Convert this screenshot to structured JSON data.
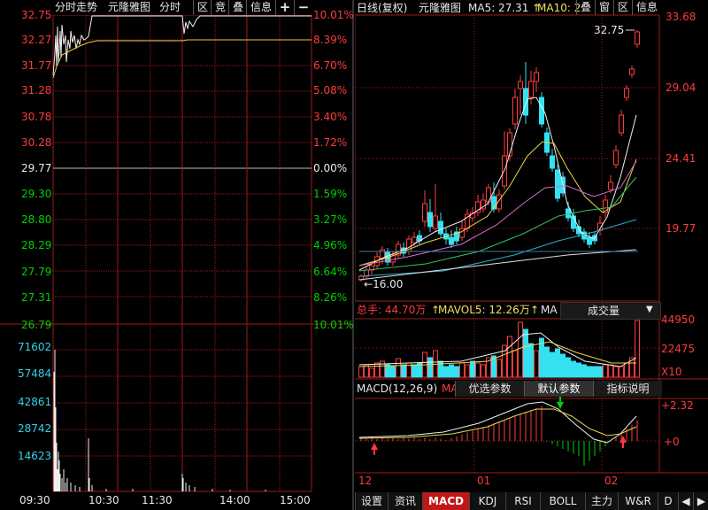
{
  "intraday": {
    "tabs": [
      "分时走势",
      "元隆雅图",
      "分时",
      "区",
      "竞",
      "叠",
      "信息"
    ],
    "plus_icon": "plus-icon",
    "minus_icon": "minus-icon",
    "price_labels": [
      {
        "text": "32.75",
        "color": "#ff3b3b"
      },
      {
        "text": "32.27",
        "color": "#ff3b3b"
      },
      {
        "text": "31.77",
        "color": "#ff3b3b"
      },
      {
        "text": "31.28",
        "color": "#ff3b3b"
      },
      {
        "text": "30.78",
        "color": "#ff3b3b"
      },
      {
        "text": "30.28",
        "color": "#ff3b3b"
      },
      {
        "text": "29.77",
        "color": "#e8e8e8"
      },
      {
        "text": "29.30",
        "color": "#00d000"
      },
      {
        "text": "28.80",
        "color": "#00d000"
      },
      {
        "text": "28.29",
        "color": "#00d000"
      },
      {
        "text": "27.79",
        "color": "#00d000"
      },
      {
        "text": "27.31",
        "color": "#00d000"
      },
      {
        "text": "26.79",
        "color": "#00d000"
      }
    ],
    "pct_labels": [
      {
        "text": "10.01%",
        "color": "#ff3b3b"
      },
      {
        "text": "8.39%",
        "color": "#ff3b3b"
      },
      {
        "text": "6.70%",
        "color": "#ff3b3b"
      },
      {
        "text": "5.08%",
        "color": "#ff3b3b"
      },
      {
        "text": "3.40%",
        "color": "#ff3b3b"
      },
      {
        "text": "1.72%",
        "color": "#ff3b3b"
      },
      {
        "text": "0.00%",
        "color": "#e8e8e8"
      },
      {
        "text": "1.59%",
        "color": "#00d000"
      },
      {
        "text": "3.27%",
        "color": "#00d000"
      },
      {
        "text": "4.96%",
        "color": "#00d000"
      },
      {
        "text": "6.64%",
        "color": "#00d000"
      },
      {
        "text": "8.26%",
        "color": "#00d000"
      },
      {
        "text": "10.01%",
        "color": "#00d000"
      }
    ],
    "volume_labels": [
      "71602",
      "57484",
      "42861",
      "28742",
      "14623"
    ],
    "time_labels": [
      "09:30",
      "10:30",
      "11:30",
      "14:00",
      "15:00"
    ]
  },
  "daily": {
    "header": {
      "label": "日线(复权)",
      "name": "元隆雅图",
      "ma5": "MA5: 27.31",
      "ma10": "MA10: 2",
      "buttons": [
        "叠",
        "窗",
        "区",
        "信息"
      ]
    },
    "price_axis": [
      "33.68",
      "29.04",
      "24.41",
      "19.77"
    ],
    "high_annotation": "32.75",
    "low_annotation": "16.00",
    "volume_header": {
      "total": "总手: 44.70万",
      "mavol": "MAVOL5: 12.26万",
      "ma_cut": "MA",
      "dropdown": "成交量"
    },
    "volume_axis": [
      "44950",
      "22475",
      "X10"
    ],
    "macd_header": {
      "label": "MACD(12,26,9)",
      "ma_cut": "MA"
    },
    "macd_params": [
      "优选参数",
      "默认参数",
      "指标说明"
    ],
    "macd_axis": [
      "+2.32",
      "+0"
    ],
    "date_labels": [
      "12",
      "01",
      "02"
    ],
    "bottom_tabs": [
      "设置",
      "资讯",
      "MACD",
      "KDJ",
      "RSI",
      "BOLL",
      "主力",
      "W&R",
      "D"
    ]
  }
}
